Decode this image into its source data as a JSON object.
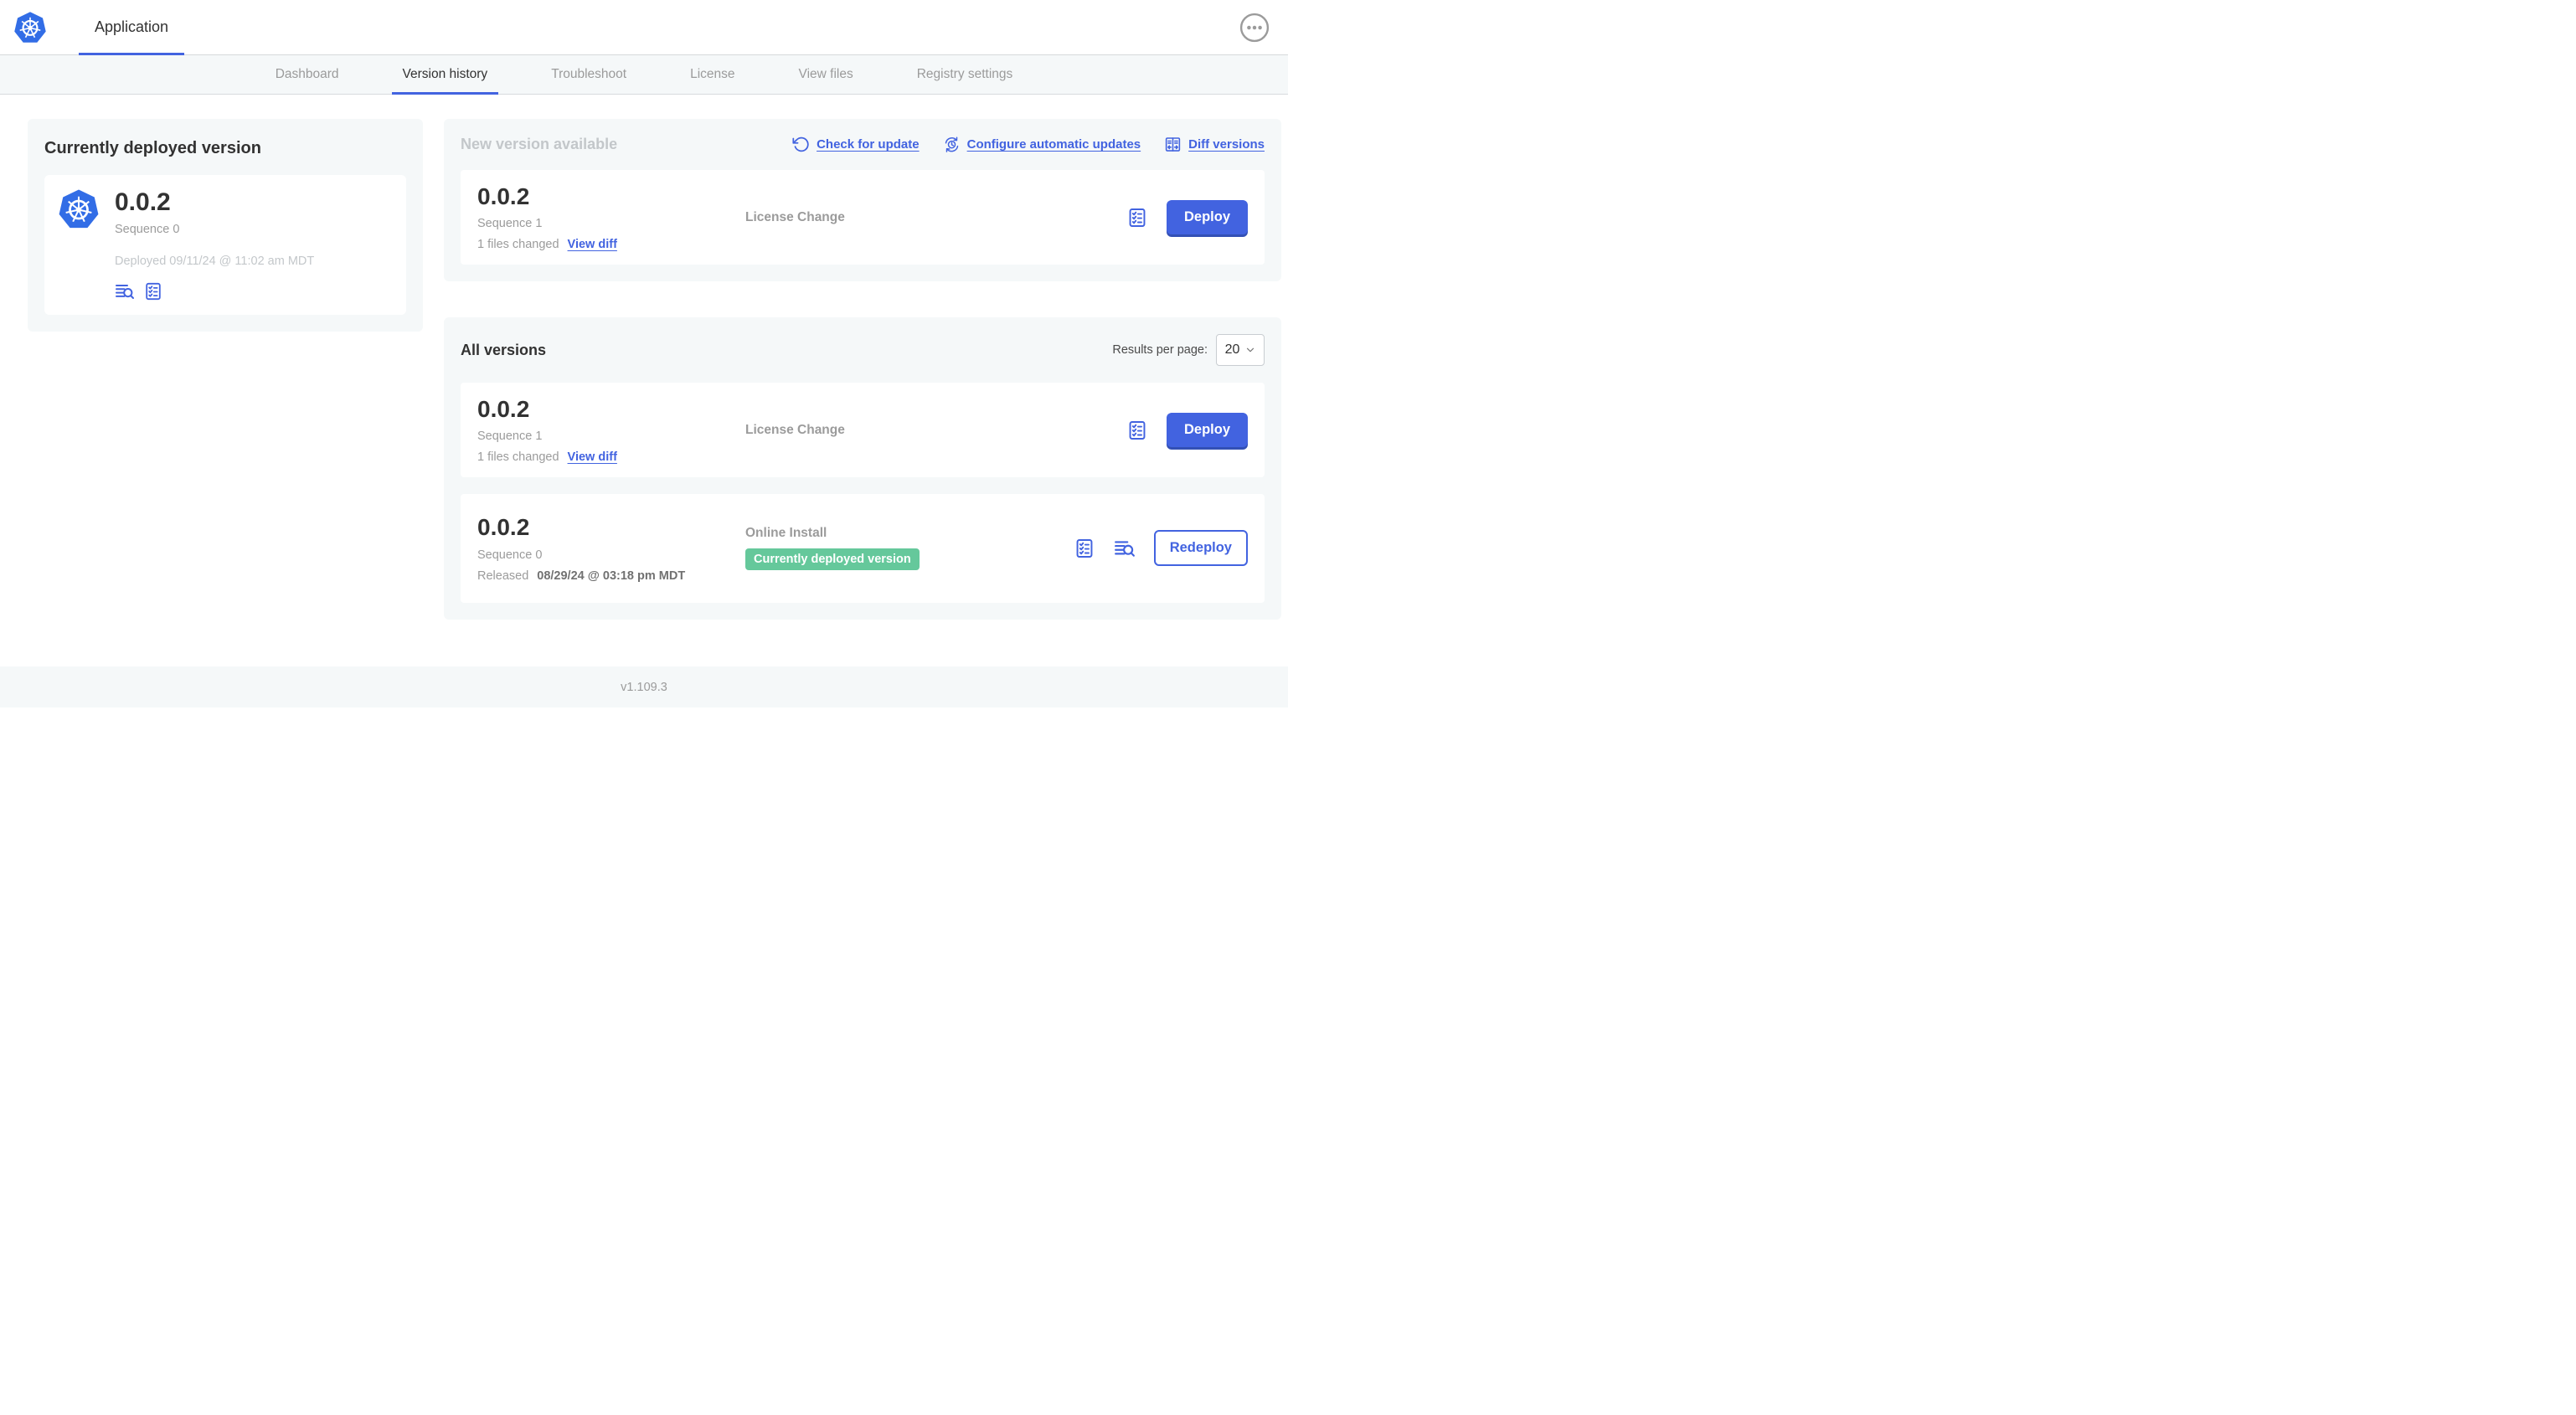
{
  "colors": {
    "accent_blue": "#4263e0",
    "kubernetes_blue": "#326de6",
    "success_green": "#65c89b",
    "text_dark": "#323232",
    "text_gray": "#9b9b9b",
    "text_light_gray": "#c3c7ca",
    "panel_gray": "#f5f8f9"
  },
  "icons": {
    "app_logo": "kubernetes-logo",
    "header_more": "ellipsis-icon",
    "check_for_update": "refresh-icon",
    "configure_updates": "auto-update-clock-icon",
    "diff_versions": "diff-icon",
    "view_logs": "view-logs-icon",
    "checklist": "preflight-checklist-icon",
    "select_caret": "chevron-down-icon"
  },
  "header": {
    "title": "Application"
  },
  "nav": {
    "tabs": [
      {
        "label": "Dashboard"
      },
      {
        "label": "Version history"
      },
      {
        "label": "Troubleshoot"
      },
      {
        "label": "License"
      },
      {
        "label": "View files"
      },
      {
        "label": "Registry settings"
      }
    ]
  },
  "deployed_panel": {
    "title": "Currently deployed version",
    "version": "0.0.2",
    "sequence": "Sequence 0",
    "deployed": "Deployed 09/11/24 @ 11:02 am MDT"
  },
  "new_version_panel": {
    "title": "New version available",
    "check_link": "Check for update",
    "configure_link": "Configure automatic updates",
    "diff_link": "Diff versions",
    "card": {
      "version": "0.0.2",
      "sequence": "Sequence 1",
      "files_changed": "1 files changed",
      "view_diff": "View diff",
      "source": "License Change",
      "action": "Deploy"
    }
  },
  "all_versions_panel": {
    "title": "All versions",
    "results_label": "Results per page:",
    "results_value": "20",
    "rows": [
      {
        "version": "0.0.2",
        "sequence": "Sequence 1",
        "files_changed": "1 files changed",
        "view_diff": "View diff",
        "source": "License Change",
        "action": "Deploy"
      },
      {
        "version": "0.0.2",
        "sequence": "Sequence 0",
        "released_prefix": "Released",
        "released_date": "08/29/24 @ 03:18 pm MDT",
        "source": "Online Install",
        "badge": "Currently deployed version",
        "action": "Redeploy"
      }
    ]
  },
  "footer": {
    "app_version": "v1.109.3"
  }
}
